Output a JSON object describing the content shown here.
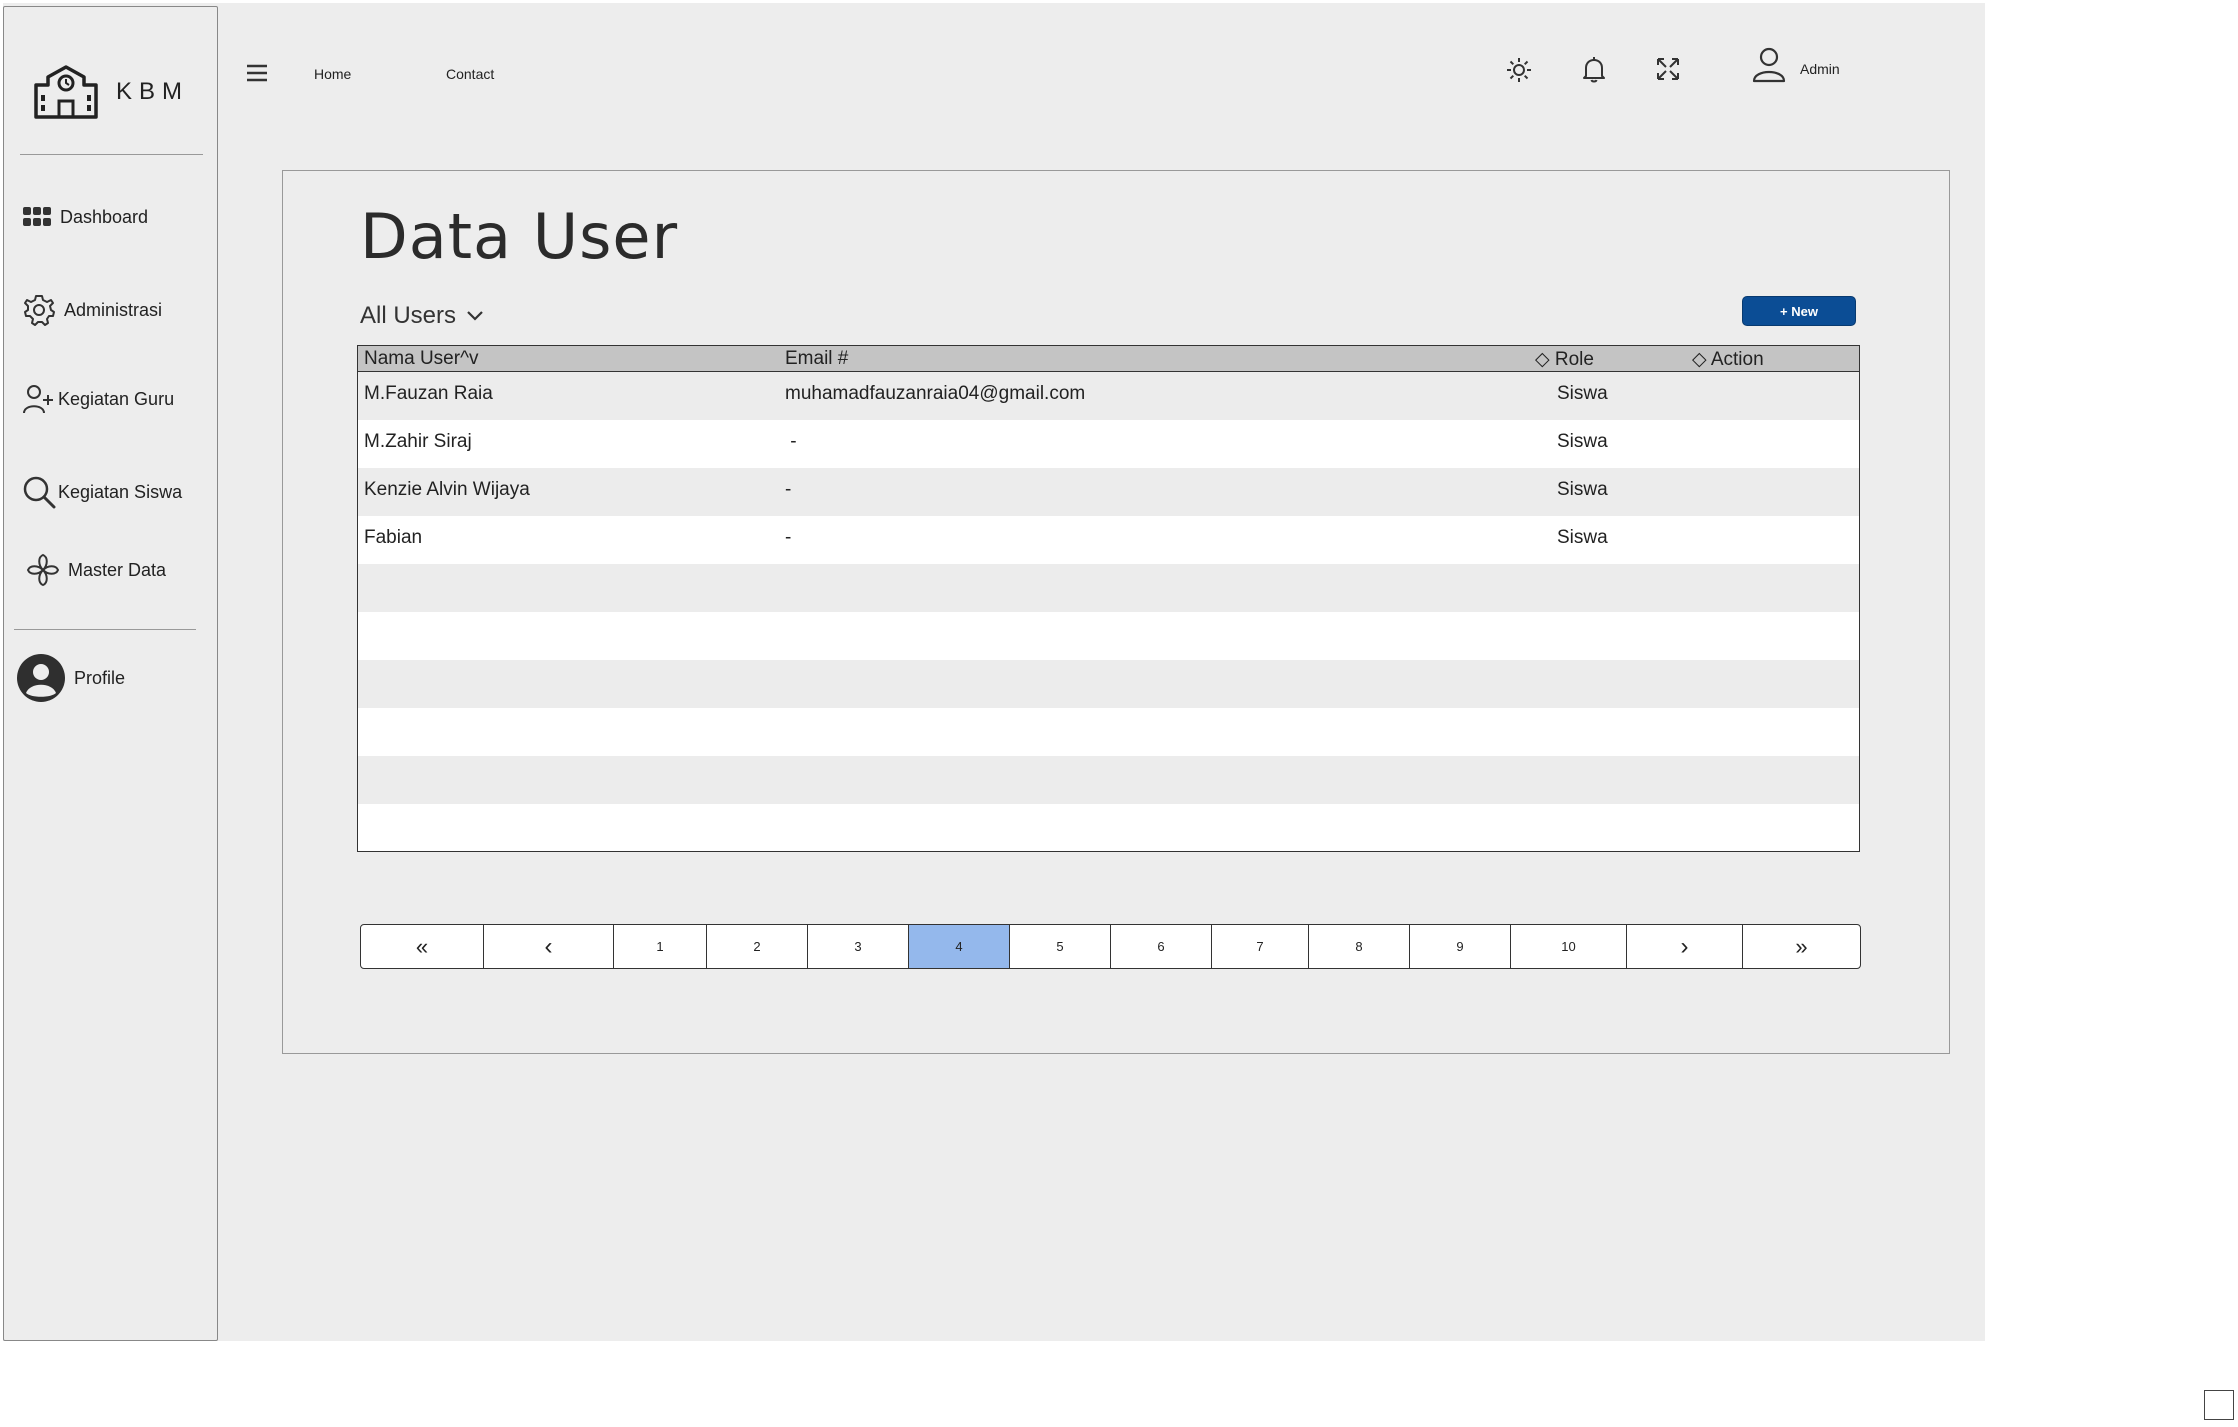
{
  "app": {
    "logo_text": "KBM"
  },
  "sidebar": {
    "items": [
      {
        "label": "Dashboard",
        "icon": "grid-icon"
      },
      {
        "label": "Administrasi",
        "icon": "gear-icon"
      },
      {
        "label": "Kegiatan Guru",
        "icon": "user-plus-icon"
      },
      {
        "label": "Kegiatan Siswa",
        "icon": "search-icon"
      },
      {
        "label": "Master Data",
        "icon": "pinwheel-icon"
      },
      {
        "label": "Profile",
        "icon": "avatar-icon"
      }
    ]
  },
  "topbar": {
    "nav": [
      "Home",
      "Contact"
    ],
    "user_label": "Admin",
    "icons": [
      "menu-icon",
      "sun-icon",
      "bell-icon",
      "fullscreen-icon",
      "user-icon"
    ]
  },
  "main": {
    "title": "Data User",
    "filter_label": "All Users",
    "new_button": "+ New",
    "table": {
      "headers": [
        "Nama User^v",
        "Email #",
        "◇ Role",
        "◇ Action"
      ],
      "rows": [
        [
          "M.Fauzan Raia",
          "muhamadfauzanraia04@gmail.com",
          "Siswa",
          ""
        ],
        [
          "M.Zahir Siraj",
          " -",
          "Siswa",
          ""
        ],
        [
          "Kenzie Alvin Wijaya",
          "-",
          "Siswa",
          ""
        ],
        [
          "Fabian",
          "-",
          "Siswa",
          ""
        ]
      ]
    },
    "pagination": {
      "buttons": [
        "«",
        "‹",
        "1",
        "2",
        "3",
        "4",
        "5",
        "6",
        "7",
        "8",
        "9",
        "10",
        "›",
        "»"
      ],
      "active": "4"
    }
  }
}
